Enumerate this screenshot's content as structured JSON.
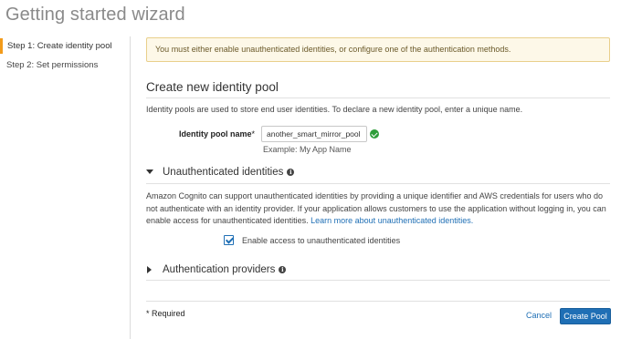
{
  "page": {
    "title": "Getting started wizard"
  },
  "sidebar": {
    "steps": [
      {
        "label": "Step 1: Create identity pool",
        "active": true
      },
      {
        "label": "Step 2: Set permissions",
        "active": false
      }
    ]
  },
  "alert": {
    "text": "You must either enable unauthenticated identities, or configure one of the authentication methods."
  },
  "form": {
    "section_title": "Create new identity pool",
    "description": "Identity pools are used to store end user identities. To declare a new identity pool, enter a unique name.",
    "pool_name": {
      "label": "Identity pool name",
      "required_mark": "*",
      "value": "another_smart_mirror_pool",
      "example": "Example: My App Name"
    }
  },
  "unauth": {
    "title": "Unauthenticated identities",
    "paragraph": "Amazon Cognito can support unauthenticated identities by providing a unique identifier and AWS credentials for users who do not authenticate with an identity provider. If your application allows customers to use the application without logging in, you can enable access for unauthenticated identities.",
    "link": "Learn more about unauthenticated identities.",
    "checkbox_label": "Enable access to unauthenticated identities",
    "checked": true
  },
  "auth": {
    "title": "Authentication providers"
  },
  "footer": {
    "required_note": "* Required",
    "cancel_label": "Cancel",
    "create_label": "Create Pool"
  },
  "colors": {
    "accent": "#1f6fb5",
    "active_step": "#f29b1b",
    "valid": "#2e9d3a"
  },
  "icons": {
    "valid": "check-circle-icon",
    "info": "info-icon"
  }
}
